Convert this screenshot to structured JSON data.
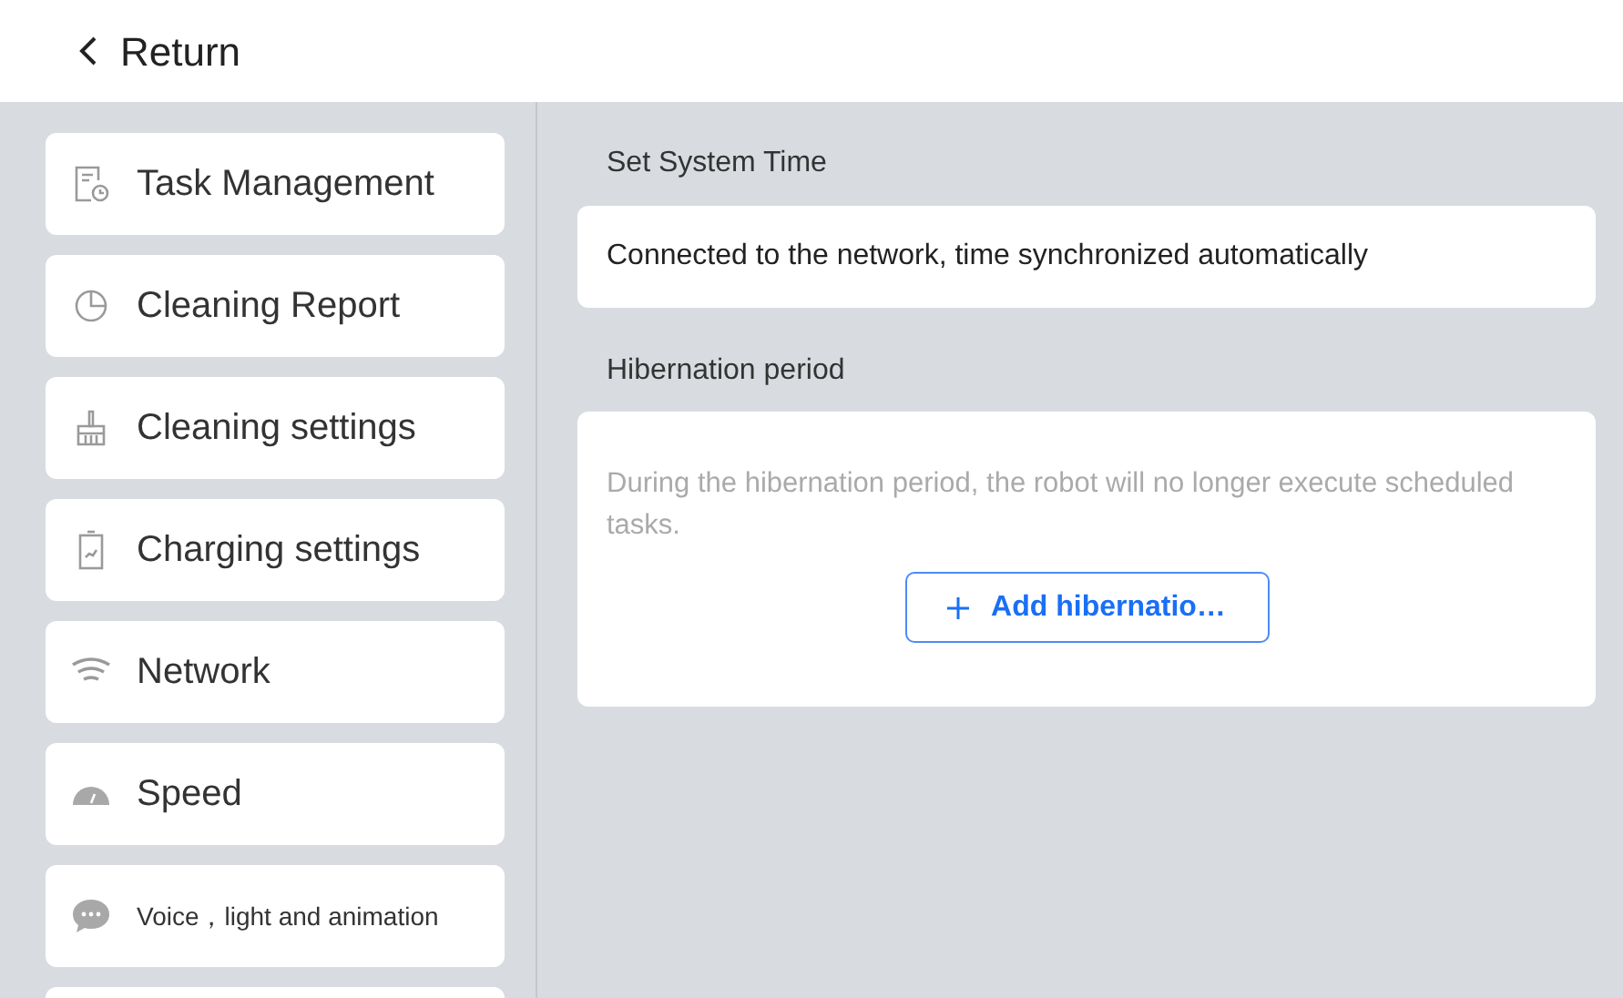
{
  "header": {
    "back_label": "Return"
  },
  "sidebar": {
    "items": [
      {
        "label": "Task Management",
        "selected": false
      },
      {
        "label": "Cleaning Report",
        "selected": false
      },
      {
        "label": "Cleaning settings",
        "selected": false
      },
      {
        "label": "Charging settings",
        "selected": false
      },
      {
        "label": "Network",
        "selected": false
      },
      {
        "label": "Speed",
        "selected": false
      },
      {
        "label": "Voice，light and animation",
        "selected": false
      }
    ]
  },
  "system_time": {
    "title": "Set System Time",
    "status": "Connected to the network, time synchronized automatically"
  },
  "hibernation": {
    "title": "Hibernation period",
    "description": "During the hibernation period, the robot will no longer execute scheduled tasks.",
    "add_button": "Add hibernatio…"
  }
}
